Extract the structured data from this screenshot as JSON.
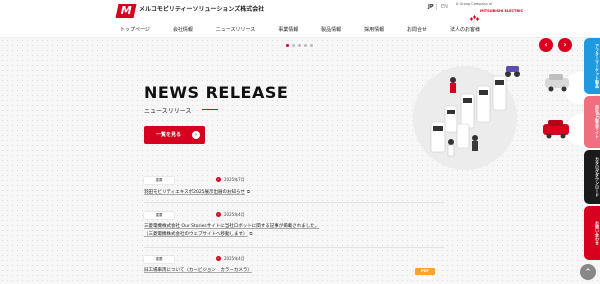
{
  "header": {
    "logo_mark": "M",
    "company_name": "メルコモビリティーソリューションズ株式会社",
    "lang_jp": "JP",
    "lang_en": "EN",
    "group_text": "A Group Company of",
    "mitsubishi_text": "MITSUBISHI ELECTRIC"
  },
  "nav": {
    "items": [
      "トップページ",
      "会社情報",
      "ニュースリリース",
      "事業情報",
      "製品情報",
      "採用情報",
      "お問合せ",
      "法人のお客様"
    ]
  },
  "slider": {
    "dots": 5,
    "active_dot": 0,
    "prev_icon": "‹",
    "next_icon": "›"
  },
  "news": {
    "title": "NEWS RELEASE",
    "subtitle": "ニュースリリース",
    "view_all": "一覧を見る",
    "view_all_arrow": "›",
    "items": [
      {
        "tag": "重要",
        "date": "2025年7月",
        "line1": "羽田モビリティエキスポ2025展示出展のお知らせ",
        "line2": ""
      },
      {
        "tag": "重要",
        "date": "2025年4月",
        "line1": "三菱電機株式会社 Our Storiesサイトに当社ロボットに関する記事が掲載されました。",
        "line2": "（三菱電機株式会社のウェブサイトへ移動します）"
      },
      {
        "tag": "重要",
        "date": "2025年4月",
        "line1": "旧工場車両について（カービジョン　カラーカメラ）",
        "line2": ""
      }
    ],
    "pdf_badge": "PDF 1.6MB"
  },
  "side_tabs": [
    {
      "label": "アフターマーケット製品",
      "color": "#1e9be0"
    },
    {
      "label": "自社EC製品サイト",
      "color": "#f06e7f"
    },
    {
      "label": "カタログダウンロード",
      "color": "#1a1a1a"
    },
    {
      "label": "お問い合わせ",
      "color": "#d7001f"
    }
  ],
  "scroll_top_icon": "^"
}
